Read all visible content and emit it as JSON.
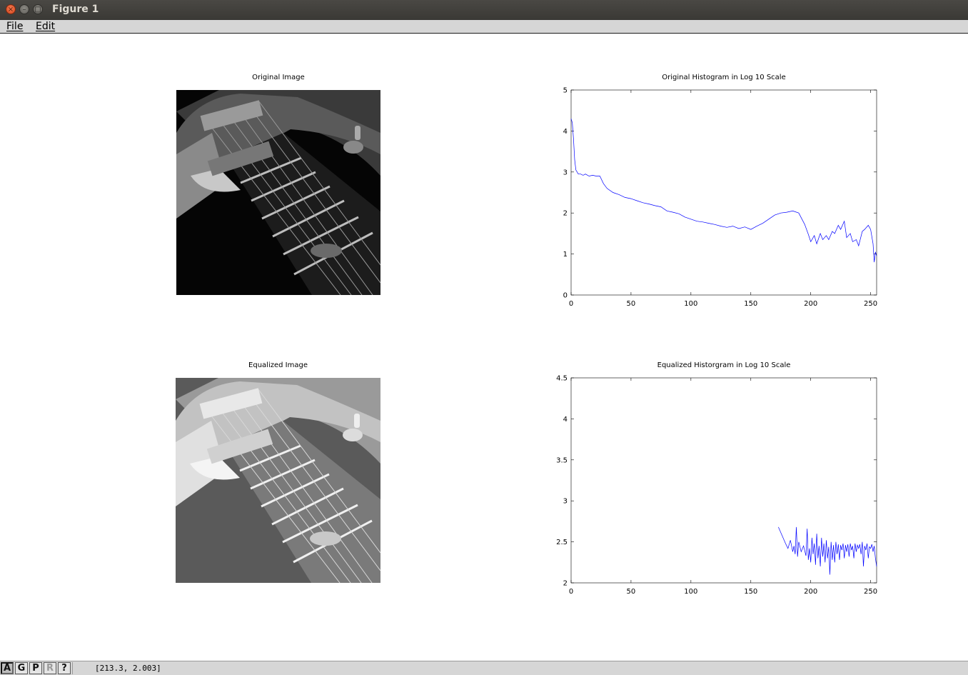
{
  "window": {
    "title": "Figure 1",
    "close_glyph": "×",
    "min_glyph": "–",
    "max_glyph": "□"
  },
  "menubar": {
    "items": [
      {
        "label": "File"
      },
      {
        "label": "Edit"
      }
    ]
  },
  "panels": {
    "original_image": {
      "title": "Original Image"
    },
    "equalized_image": {
      "title": "Equalized Image"
    }
  },
  "chart_data": [
    {
      "type": "line",
      "title": "Original Histogram in Log 10 Scale",
      "xlabel": "",
      "ylabel": "",
      "xlim": [
        0,
        255
      ],
      "ylim": [
        0,
        5
      ],
      "xticks": [
        0,
        50,
        100,
        150,
        200,
        250
      ],
      "yticks": [
        0,
        1,
        2,
        3,
        4,
        5
      ],
      "grid": false,
      "series": [
        {
          "color": "#0000ff",
          "x": [
            0,
            1,
            2,
            3,
            4,
            6,
            8,
            10,
            12,
            15,
            18,
            21,
            24,
            27,
            30,
            35,
            40,
            45,
            50,
            55,
            60,
            65,
            70,
            75,
            80,
            85,
            90,
            95,
            100,
            105,
            110,
            115,
            120,
            125,
            130,
            135,
            140,
            145,
            150,
            155,
            160,
            165,
            170,
            175,
            180,
            185,
            190,
            195,
            198,
            200,
            203,
            205,
            208,
            210,
            213,
            215,
            218,
            220,
            223,
            225,
            228,
            230,
            233,
            235,
            238,
            240,
            243,
            245,
            248,
            250,
            252,
            253,
            254,
            255
          ],
          "y": [
            4.3,
            4.2,
            3.8,
            3.3,
            3.05,
            2.95,
            2.95,
            2.92,
            2.95,
            2.9,
            2.92,
            2.9,
            2.9,
            2.72,
            2.6,
            2.5,
            2.45,
            2.38,
            2.35,
            2.3,
            2.25,
            2.22,
            2.18,
            2.15,
            2.05,
            2.02,
            1.98,
            1.9,
            1.85,
            1.8,
            1.78,
            1.75,
            1.72,
            1.68,
            1.65,
            1.68,
            1.62,
            1.66,
            1.6,
            1.68,
            1.75,
            1.85,
            1.95,
            2.0,
            2.02,
            2.05,
            2.0,
            1.72,
            1.48,
            1.3,
            1.45,
            1.25,
            1.5,
            1.35,
            1.45,
            1.35,
            1.55,
            1.5,
            1.7,
            1.6,
            1.8,
            1.4,
            1.5,
            1.3,
            1.35,
            1.2,
            1.55,
            1.6,
            1.7,
            1.6,
            1.25,
            0.8,
            1.05,
            0.95
          ]
        }
      ]
    },
    {
      "type": "line",
      "title": "Equalized Historgram in Log 10 Scale",
      "xlabel": "",
      "ylabel": "",
      "xlim": [
        0,
        255
      ],
      "ylim": [
        2,
        4.5
      ],
      "xticks": [
        0,
        50,
        100,
        150,
        200,
        250
      ],
      "yticks": [
        2,
        2.5,
        3,
        3.5,
        4,
        4.5
      ],
      "grid": false,
      "series": [
        {
          "color": "#0000ff",
          "x": [
            173,
            176,
            179,
            181,
            183,
            185,
            186,
            187,
            188,
            189,
            190,
            192,
            194,
            196,
            197,
            198,
            199,
            200,
            201,
            202,
            203,
            204,
            205,
            206,
            207,
            208,
            209,
            210,
            211,
            212,
            213,
            214,
            215,
            216,
            217,
            218,
            219,
            220,
            221,
            222,
            223,
            224,
            225,
            226,
            227,
            228,
            229,
            230,
            231,
            232,
            233,
            234,
            235,
            236,
            237,
            238,
            239,
            240,
            241,
            242,
            243,
            244,
            245,
            246,
            247,
            248,
            249,
            250,
            251,
            252,
            253,
            254,
            255
          ],
          "y": [
            2.68,
            2.58,
            2.48,
            2.42,
            2.52,
            2.38,
            2.45,
            2.35,
            2.68,
            2.32,
            2.5,
            2.38,
            2.45,
            2.33,
            2.66,
            2.28,
            2.42,
            2.25,
            2.55,
            2.35,
            2.48,
            2.22,
            2.6,
            2.3,
            2.45,
            2.2,
            2.55,
            2.32,
            2.48,
            2.25,
            2.52,
            2.3,
            2.44,
            2.1,
            2.5,
            2.28,
            2.46,
            2.25,
            2.5,
            2.35,
            2.47,
            2.28,
            2.46,
            2.4,
            2.48,
            2.3,
            2.46,
            2.38,
            2.47,
            2.32,
            2.48,
            2.4,
            2.45,
            2.3,
            2.48,
            2.38,
            2.46,
            2.42,
            2.47,
            2.35,
            2.5,
            2.2,
            2.45,
            2.4,
            2.48,
            2.3,
            2.44,
            2.42,
            2.47,
            2.38,
            2.45,
            2.3,
            2.2
          ]
        }
      ]
    }
  ],
  "statusbar": {
    "tools": [
      {
        "label": "A",
        "state": "active"
      },
      {
        "label": "G",
        "state": "normal"
      },
      {
        "label": "P",
        "state": "normal"
      },
      {
        "label": "R",
        "state": "disabled"
      },
      {
        "label": "?",
        "state": "normal"
      }
    ],
    "coords": "[213.3, 2.003]"
  }
}
